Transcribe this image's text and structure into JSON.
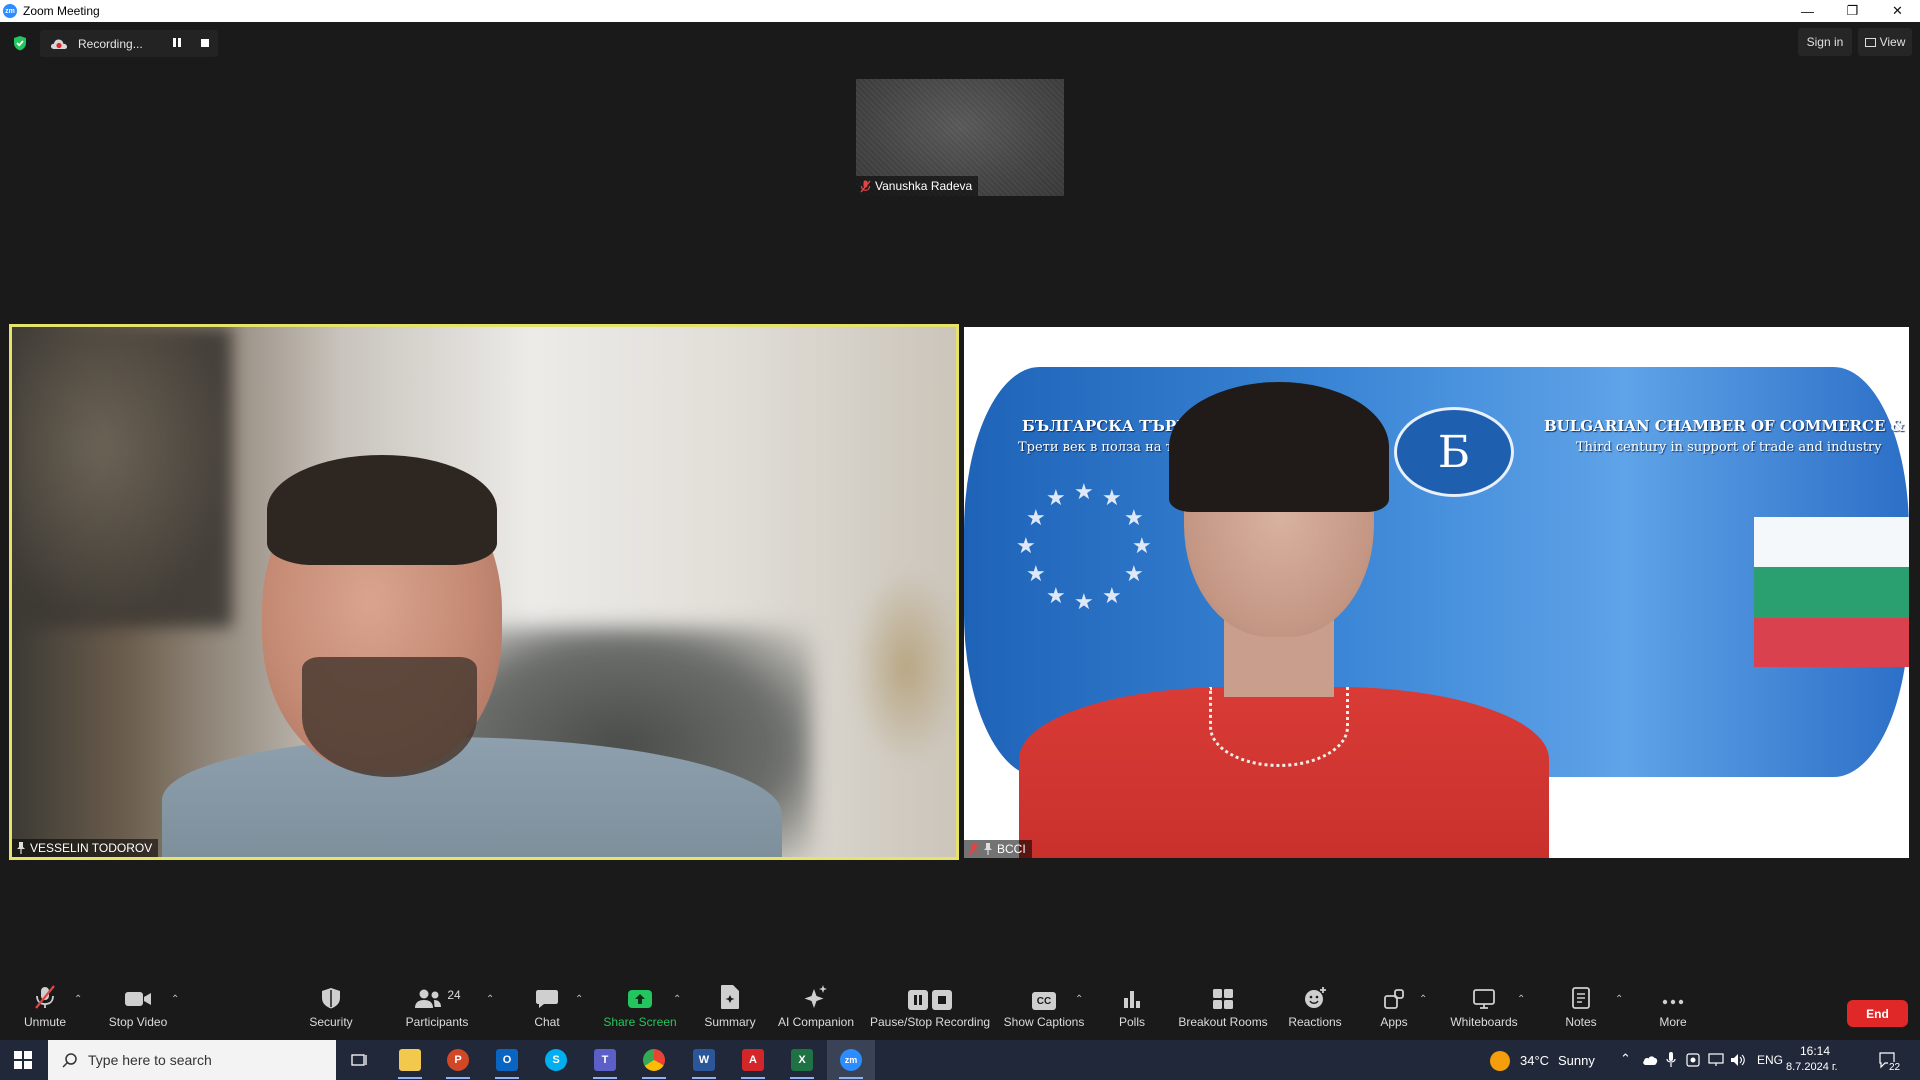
{
  "window": {
    "title": "Zoom Meeting",
    "minimize": "—",
    "restore": "❐",
    "close": "✕"
  },
  "topbar": {
    "recording_label": "Recording...",
    "sign_in": "Sign in",
    "view": "View"
  },
  "participants": {
    "thumbnail_name": "Vanushka Radeva",
    "left_name": "VESSELIN TODOROV",
    "right_name": "BCCI"
  },
  "banner": {
    "bg_title": "БЪЛГАРСКА ТЪРГОВСКО",
    "bg_sub": "Трети век в полза на тър",
    "en_title": "BULGARIAN CHAMBER OF COMMERCE & INDUSTRY",
    "en_sub": "Third century in support of trade and industry",
    "logo_glyph": "Б"
  },
  "toolbar": {
    "unmute": "Unmute",
    "stop_video": "Stop Video",
    "security": "Security",
    "participants": "Participants",
    "participants_count": "24",
    "chat": "Chat",
    "share_screen": "Share Screen",
    "summary": "Summary",
    "ai_companion": "AI Companion",
    "pause_stop_recording": "Pause/Stop Recording",
    "show_captions": "Show Captions",
    "polls": "Polls",
    "breakout_rooms": "Breakout Rooms",
    "reactions": "Reactions",
    "apps": "Apps",
    "whiteboards": "Whiteboards",
    "notes": "Notes",
    "more": "More",
    "end": "End",
    "cc": "CC"
  },
  "taskbar": {
    "search_placeholder": "Type here to search",
    "temperature": "34°C",
    "weather": "Sunny",
    "language": "ENG",
    "time": "16:14",
    "date": "8.7.2024 г.",
    "notifications": "22",
    "apps": [
      "task-view",
      "file-explorer",
      "powerpoint",
      "outlook",
      "skype",
      "teams",
      "chrome",
      "word",
      "acrobat",
      "excel",
      "zoom"
    ]
  },
  "colors": {
    "background": "#1a1a1a",
    "active_speaker_border": "#e5e36a",
    "share_green": "#22c55e",
    "end_red": "#e02828",
    "taskbar": "#20283a",
    "zoom_blue": "#2d8cff"
  }
}
